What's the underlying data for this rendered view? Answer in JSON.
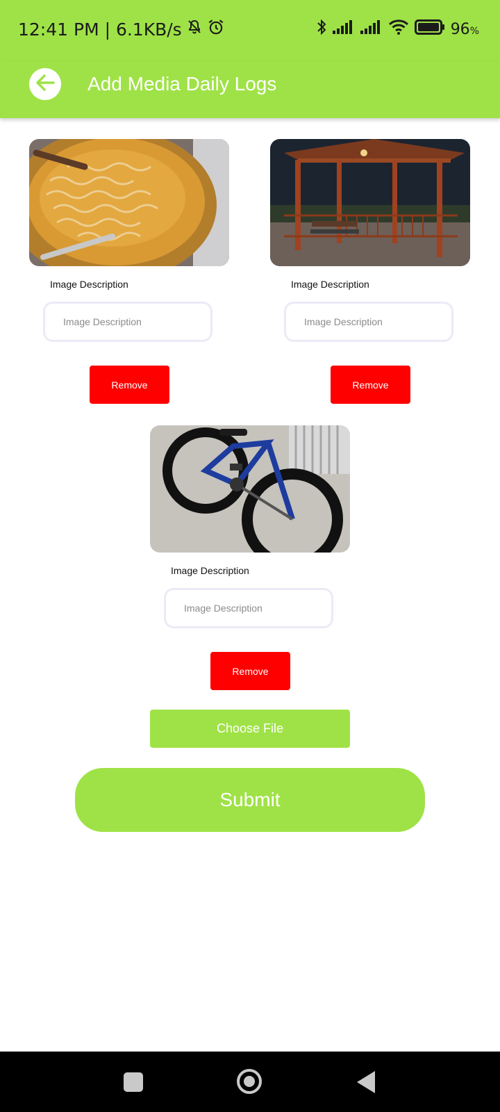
{
  "status": {
    "time_speed": "12:41 PM | 6.1KB/s",
    "battery": "96",
    "battery_unit": "%"
  },
  "appbar": {
    "title": "Add Media Daily Logs"
  },
  "media_items": [
    {
      "image_name": "noodles-photo",
      "label": "Image Description",
      "placeholder": "Image Description",
      "remove_label": "Remove"
    },
    {
      "image_name": "gazebo-photo",
      "label": "Image Description",
      "placeholder": "Image Description",
      "remove_label": "Remove"
    },
    {
      "image_name": "bicycle-photo",
      "label": "Image Description",
      "placeholder": "Image Description",
      "remove_label": "Remove"
    }
  ],
  "actions": {
    "choose_file": "Choose File",
    "submit": "Submit"
  },
  "colors": {
    "accent": "#9fe247",
    "danger": "#ff0000"
  }
}
